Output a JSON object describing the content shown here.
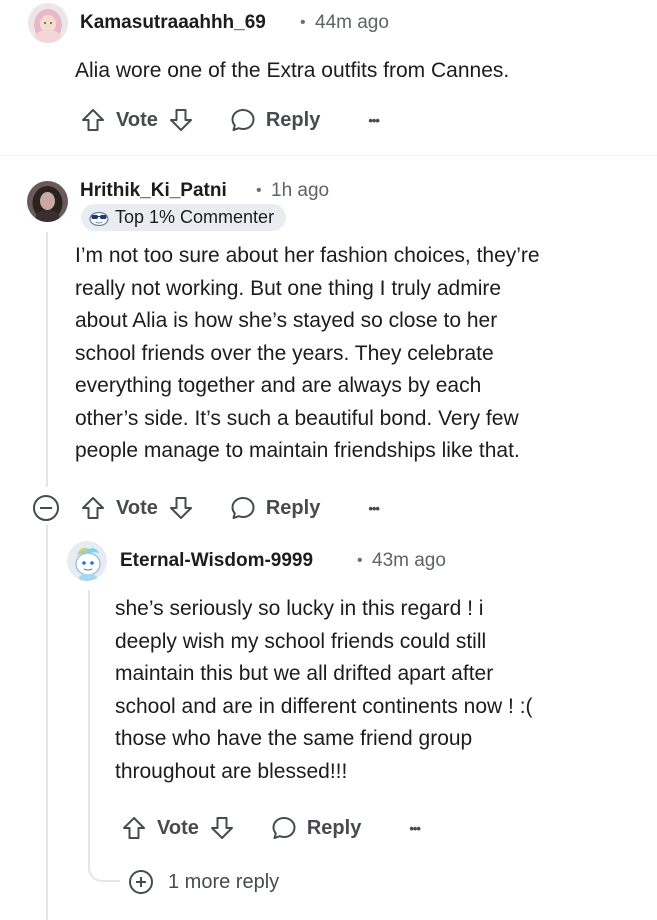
{
  "comments": [
    {
      "username": "Kamasutraaahhh_69",
      "separator": "•",
      "timestamp": "44m ago",
      "avatar_icon": "avatar-pink-hair-icon",
      "body": [
        "Alia wore one of the Extra outfits from Cannes."
      ],
      "actions": {
        "vote": "Vote",
        "reply": "Reply",
        "more": "•••"
      }
    },
    {
      "username": "Hrithik_Ki_Patni",
      "separator": "•",
      "timestamp": "1h ago",
      "avatar_icon": "avatar-dark-hair-icon",
      "badge": {
        "label": "Top 1% Commenter",
        "icon": "sunglasses-snoo-icon"
      },
      "body": [
        "I’m not too sure about her fashion choices, they’re",
        "really not working. But one thing I truly admire",
        "about Alia is how she’s stayed so close to her",
        "school friends over the years. They celebrate",
        "everything together and are always by each",
        "other’s side. It’s such a beautiful bond. Very few",
        "people manage to maintain friendships like that."
      ],
      "actions": {
        "vote": "Vote",
        "reply": "Reply",
        "more": "•••",
        "collapse": "collapse-minus-icon"
      }
    },
    {
      "username": "Eternal-Wisdom-9999",
      "separator": "•",
      "timestamp": "43m ago",
      "avatar_icon": "avatar-unicorn-snoo-icon",
      "body": [
        "she’s seriously so lucky in this regard ! i",
        "deeply wish my school friends could still",
        "maintain this but we all drifted apart after",
        "school and are in different continents now ! :(",
        "those who have the same friend group",
        "throughout are blessed!!!"
      ],
      "actions": {
        "vote": "Vote",
        "reply": "Reply",
        "more": "•••"
      }
    }
  ],
  "more_replies": {
    "label": "1 more reply",
    "icon": "plus-circle-icon"
  },
  "colors": {
    "text": "#1c1c1c",
    "muted": "#5f6368",
    "action": "#464b4f",
    "badge_bg": "#e9edf2",
    "thread_line": "#e3e5e8"
  }
}
